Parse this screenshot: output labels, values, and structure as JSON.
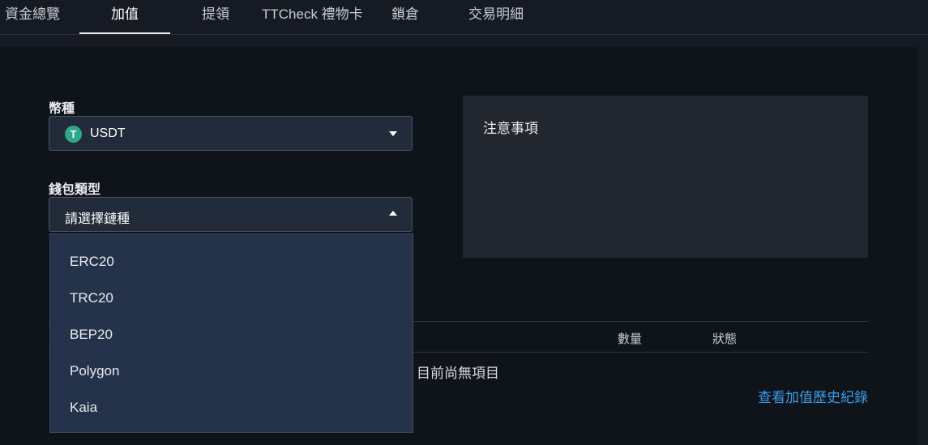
{
  "tabs": [
    {
      "label": "資金總覽"
    },
    {
      "label": "加值"
    },
    {
      "label": "提領"
    },
    {
      "label": "TTCheck 禮物卡"
    },
    {
      "label": "鎖倉"
    },
    {
      "label": "交易明細"
    }
  ],
  "active_tab": "加值",
  "form": {
    "currency_label": "幣種",
    "currency_value": "USDT",
    "currency_icon": "tether-icon",
    "currency_icon_glyph": "T",
    "wallet_label": "錢包類型",
    "wallet_placeholder": "請選擇鏈種"
  },
  "dropdown_options": [
    "ERC20",
    "TRC20",
    "BEP20",
    "Polygon",
    "Kaia"
  ],
  "notice": {
    "title": "注意事項"
  },
  "table": {
    "headers": {
      "amount": "數量",
      "status": "狀態"
    },
    "empty_text": "目前尚無項目"
  },
  "history_link": "查看加值歷史紀錄",
  "colors": {
    "accent_link": "#3a9ce8",
    "usdt_green": "#2fa88a",
    "dropdown_bg": "#243349"
  }
}
